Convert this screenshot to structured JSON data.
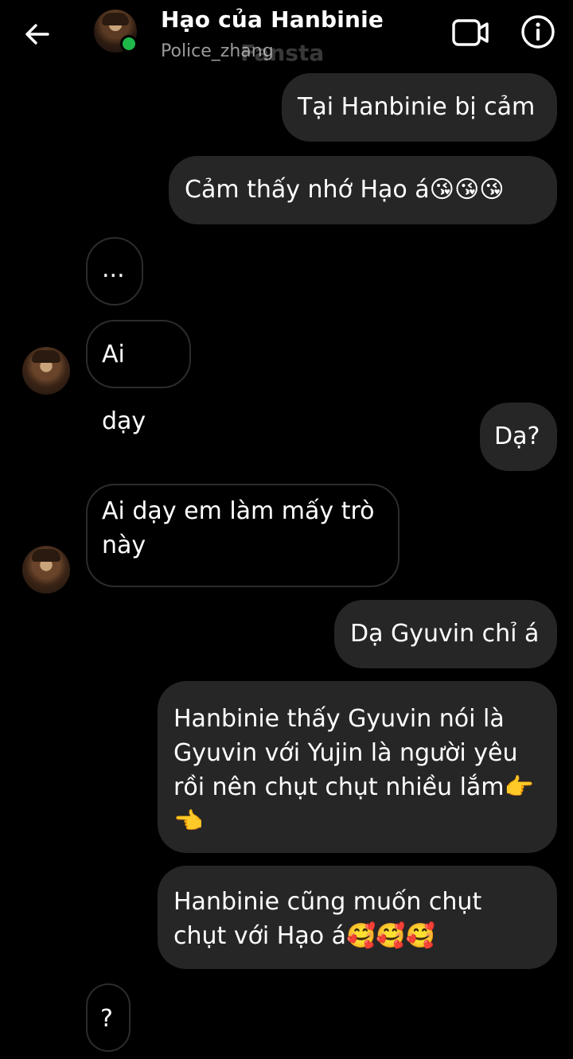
{
  "header": {
    "name": "Hạo của Hanbinie",
    "username": "Police_zhang",
    "watermark": "Fansta",
    "back_icon": "arrow-left-icon",
    "video_icon": "video-camera-icon",
    "info_icon": "info-circle-icon",
    "online_color": "#1fb94b"
  },
  "messages": [
    {
      "side": "out",
      "text": "Tại Hanbinie bị cảm"
    },
    {
      "side": "out",
      "text": "Cảm thấy nhớ Hạo á😘😘😘"
    },
    {
      "side": "in",
      "text": "..."
    },
    {
      "side": "in",
      "text": "Ai dạy"
    },
    {
      "side": "out",
      "text": "Dạ?"
    },
    {
      "side": "in",
      "text": "Ai dạy em làm mấy trò này"
    },
    {
      "side": "out",
      "text": "Dạ Gyuvin chỉ á"
    },
    {
      "side": "out",
      "text": "Hanbinie thấy Gyuvin nói là Gyuvin với Yujin là người yêu rồi nên chụt chụt nhiều lắm👉👈"
    },
    {
      "side": "out",
      "text": "Hanbinie cũng muốn chụt chụt với Hạo á🥰🥰🥰"
    },
    {
      "side": "in",
      "text": "?"
    }
  ],
  "colors": {
    "background": "#000000",
    "outgoing_bubble": "#262626",
    "incoming_border": "#2c2c2c"
  }
}
